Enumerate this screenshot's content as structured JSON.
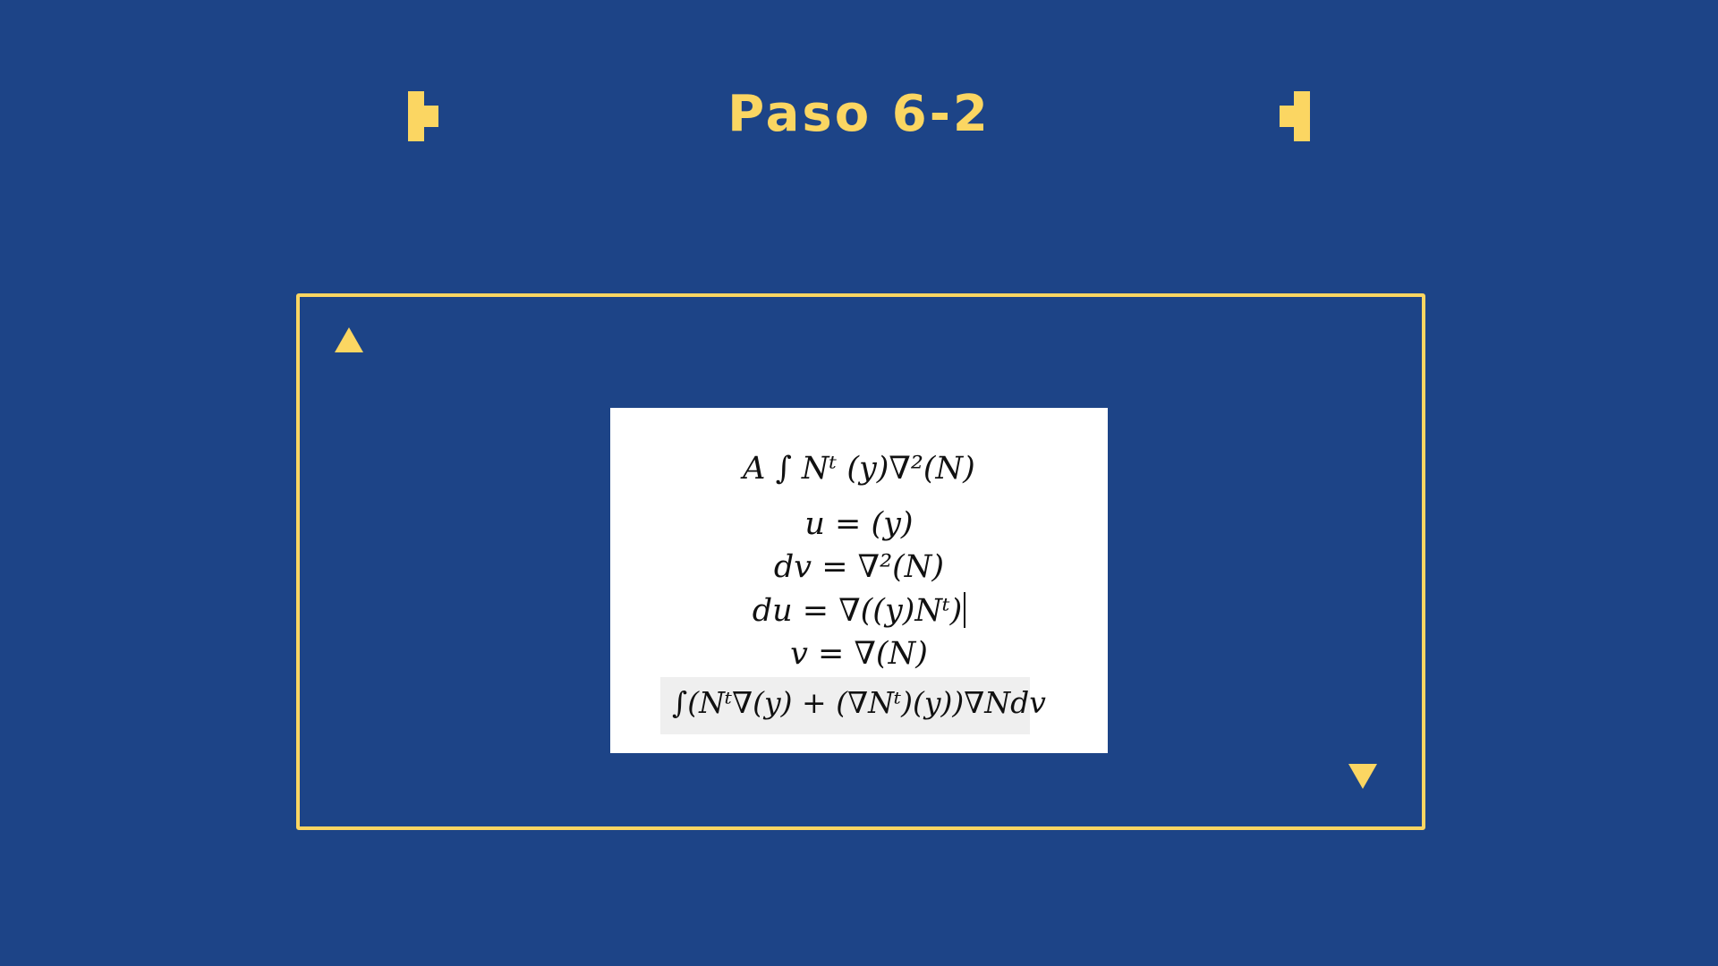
{
  "slide": {
    "title": "Paso 6-2",
    "background_color": "#1d4487",
    "accent_color": "#fbd662"
  },
  "decorations": {
    "left_bracket": "bracket-icon",
    "right_bracket": "bracket-icon",
    "top_triangle": "triangle-up-icon",
    "bottom_triangle": "triangle-down-icon"
  },
  "equations": {
    "eq1": "A ∫ Nᵗ (y)∇²(N)",
    "eq2": "u = (y)",
    "eq3": "dv = ∇²(N)",
    "eq4": "du = ∇((y)Nᵗ)",
    "eq5": "v = ∇(N)",
    "eq6": "∫(Nᵗ∇(y) + (∇Nᵗ)(y))∇Ndv"
  }
}
